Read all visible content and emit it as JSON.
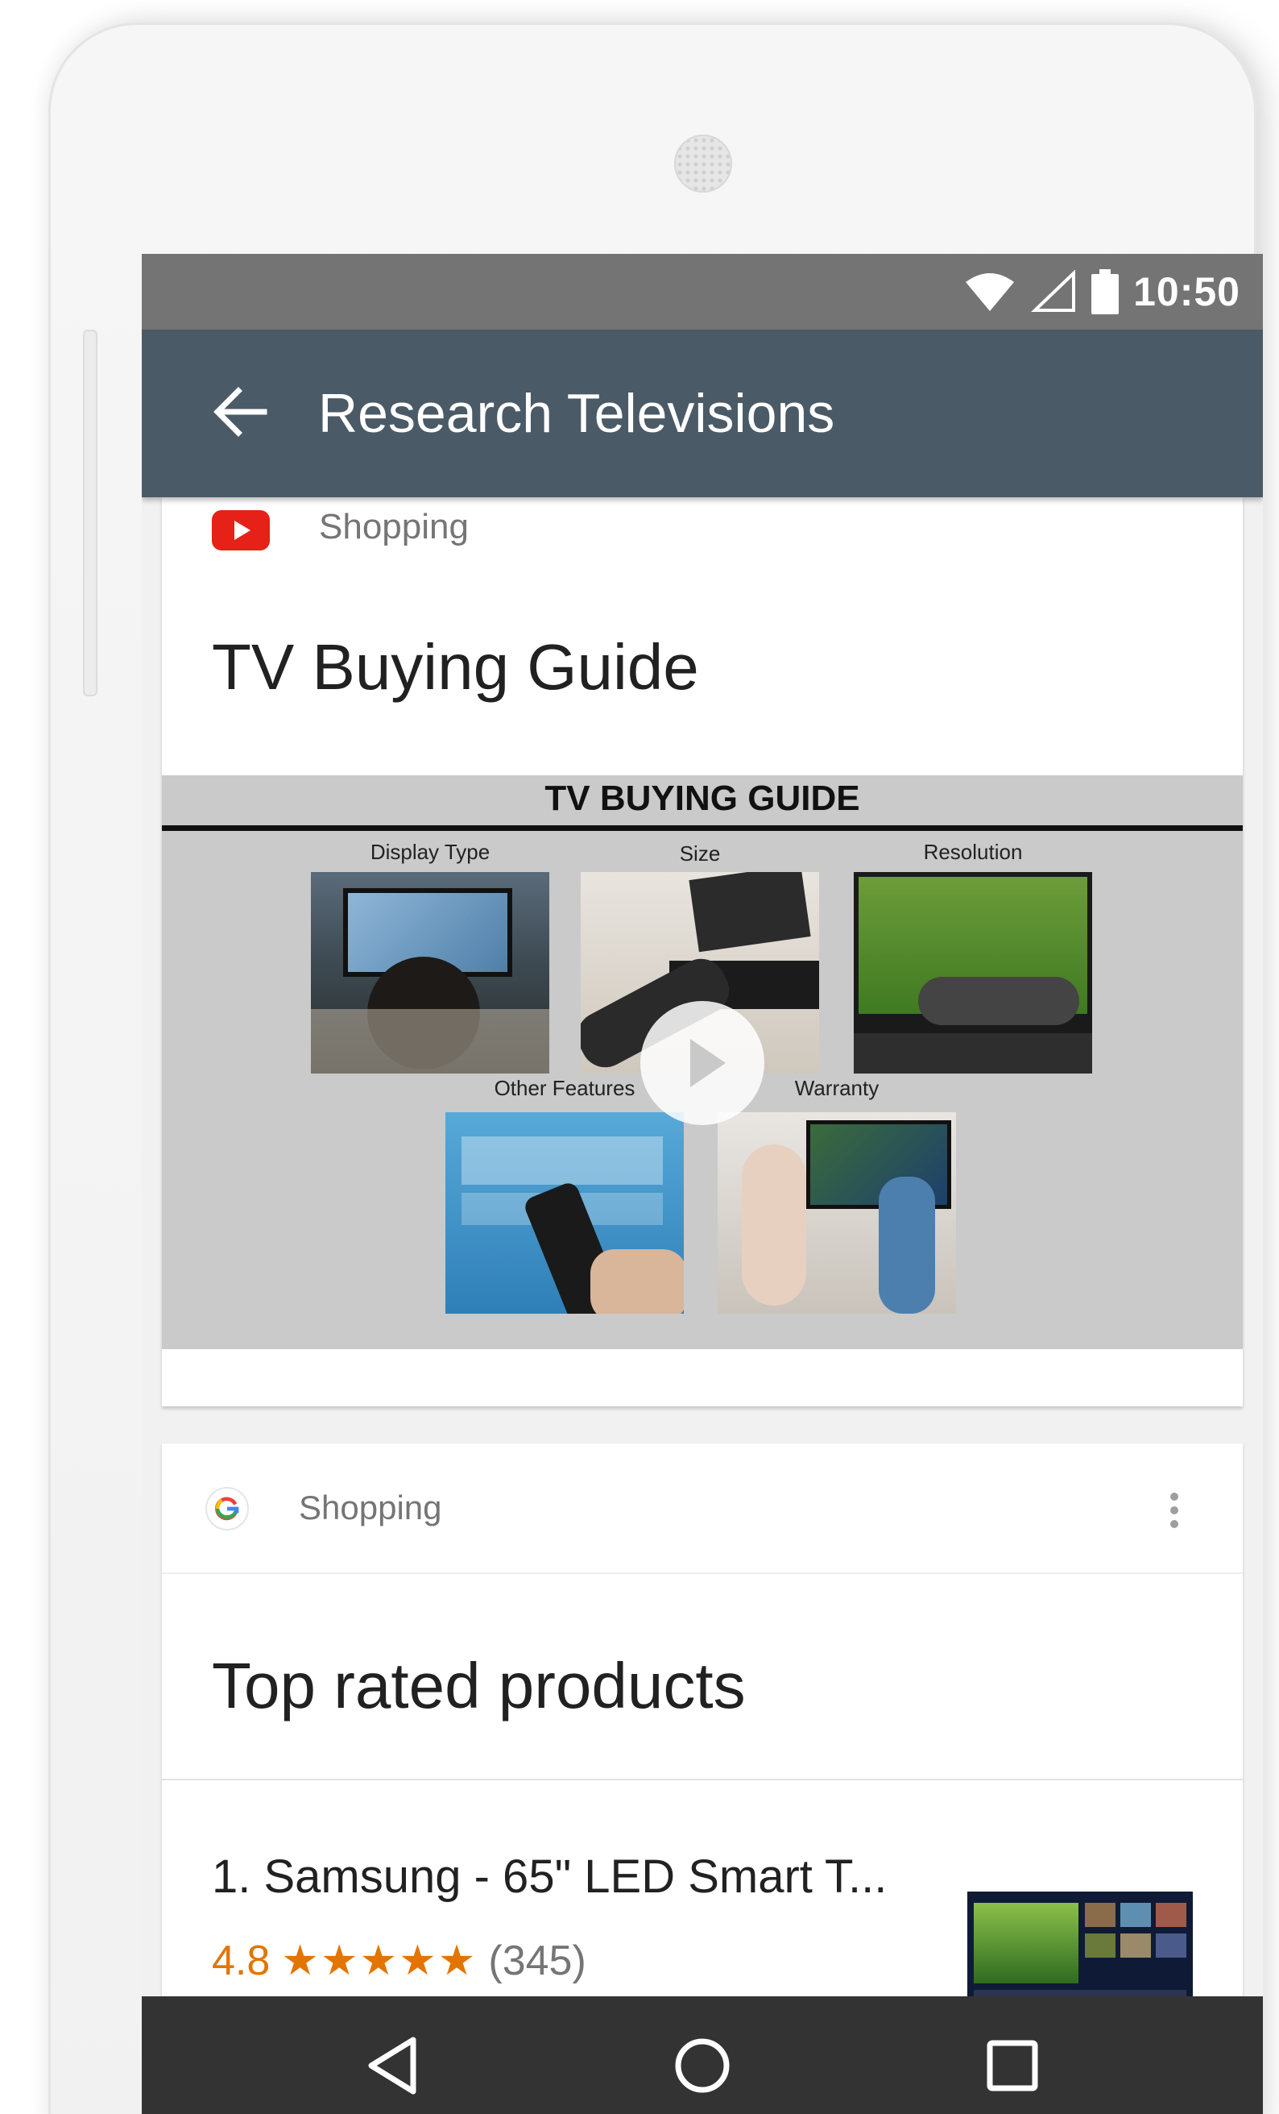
{
  "status_bar": {
    "time": "10:50"
  },
  "app_bar": {
    "title": "Research Televisions"
  },
  "video_card": {
    "source": "Shopping",
    "title": "TV Buying Guide",
    "thumbnail": {
      "heading": "TV BUYING GUIDE",
      "panels": [
        "Display Type",
        "Size",
        "Resolution",
        "Other Features",
        "Warranty"
      ]
    }
  },
  "products_card": {
    "source": "Shopping",
    "title": "Top rated products",
    "items": [
      {
        "name": "1. Samsung - 65\" LED Smart T...",
        "rating": "4.8",
        "stars": "★★★★★",
        "reviews": "(345)"
      }
    ]
  },
  "colors": {
    "app_bar": "#4a5a66",
    "status_bar": "#747474",
    "rating": "#e37400",
    "youtube": "#e62117"
  }
}
